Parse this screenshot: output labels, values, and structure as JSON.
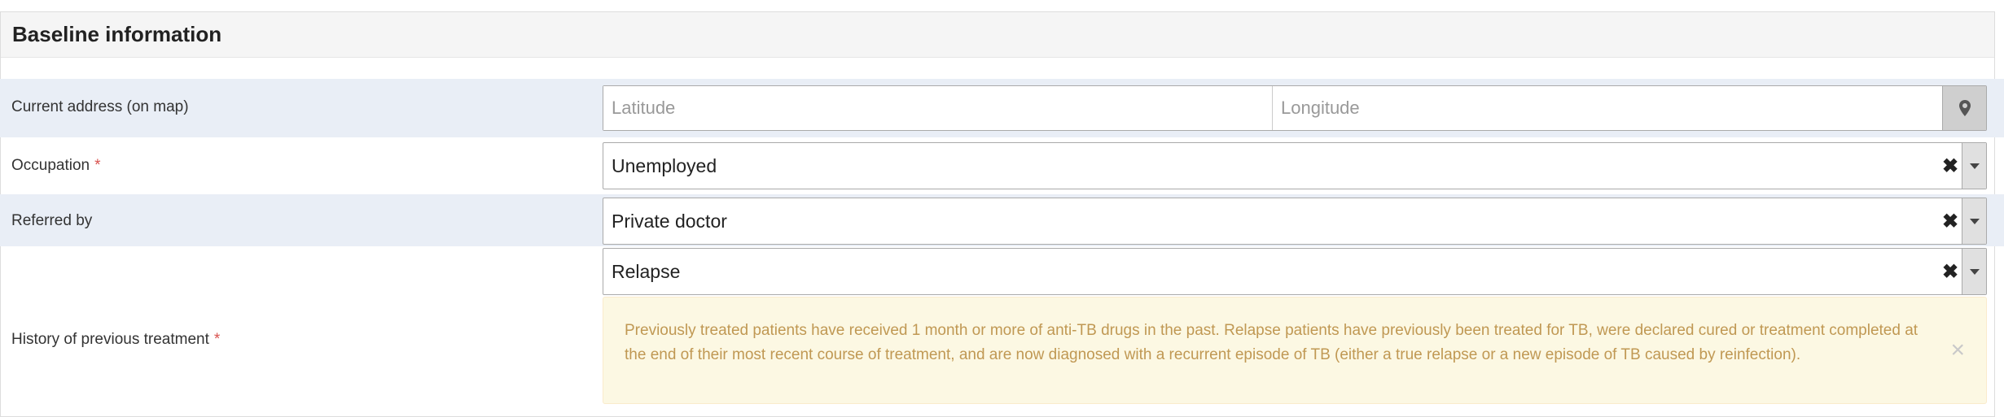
{
  "panel": {
    "title": "Baseline information"
  },
  "address": {
    "label": "Current address (on map)",
    "latitude_placeholder": "Latitude",
    "longitude_placeholder": "Longitude",
    "button_icon": "map-marker-icon"
  },
  "occupation": {
    "label": "Occupation",
    "required_mark": "*",
    "value": "Unemployed"
  },
  "referred_by": {
    "label": "Referred by",
    "value": "Private doctor"
  },
  "history": {
    "label": "History of previous treatment",
    "required_mark": "*",
    "value": "Relapse",
    "info_text": "Previously treated patients have received 1 month or more of anti-TB drugs in the past. Relapse patients have previously been treated for TB, were declared cured or treatment completed at the end of their most recent course of treatment, and are now diagnosed with a recurrent episode of TB (either a true relapse or a new episode of TB caused by reinfection).",
    "close_glyph": "×"
  },
  "select_controls": {
    "clear_glyph": "✖"
  },
  "colors": {
    "row_highlight": "#e9eef6",
    "required": "#d9534f",
    "alert_bg": "#fcf8e3",
    "alert_text": "#c09853"
  }
}
